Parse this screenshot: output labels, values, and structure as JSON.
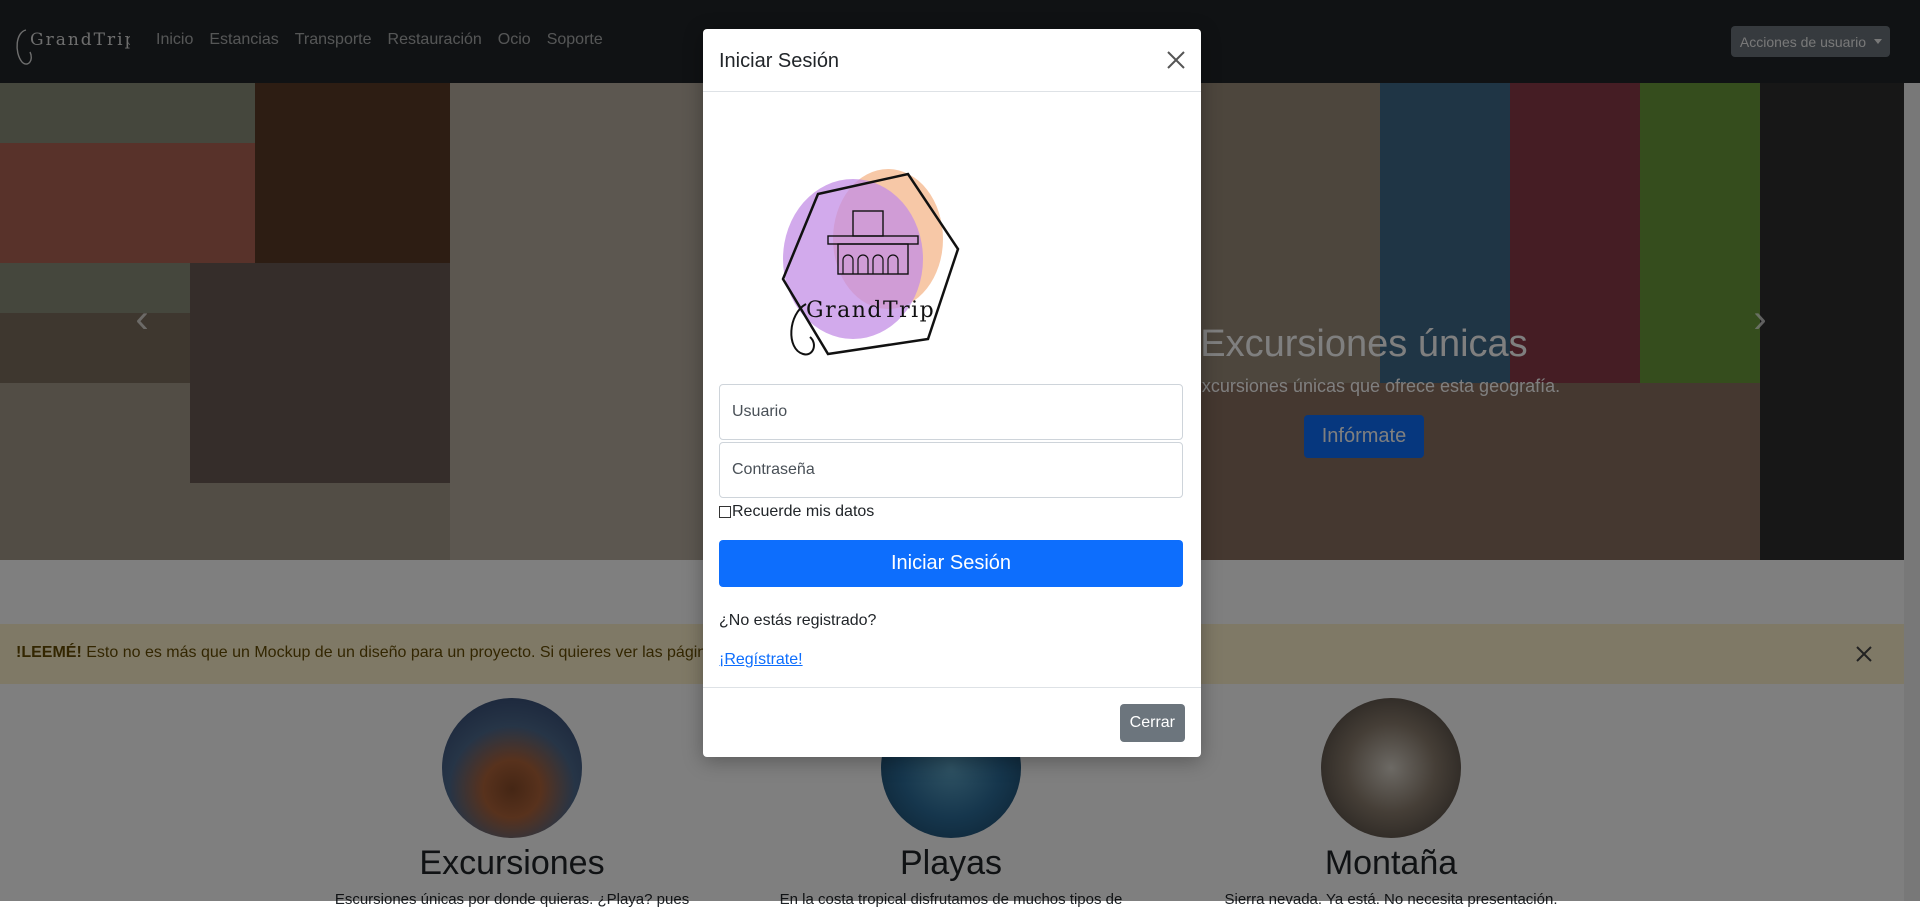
{
  "navbar": {
    "brand_text": "GrandTrip",
    "links": [
      "Inicio",
      "Estancias",
      "Transporte",
      "Restauración",
      "Ocio",
      "Soporte"
    ],
    "user_actions": "Acciones de usuario"
  },
  "carousel": {
    "caption_title": "Excursiones únicas",
    "caption_text": "as excursiones únicas que ofrece esta geografía.",
    "caption_button": "Infórmate"
  },
  "alert": {
    "strong": "!LEEMÉ!",
    "text": "Esto no es más que un Mockup de un diseño para un proyecto. Si quieres ver las páginas"
  },
  "features": [
    {
      "name": "Excursiones",
      "description": "Escursiones únicas por donde quieras. ¿Playa? pues"
    },
    {
      "name": "Playas",
      "description": "En la costa tropical disfrutamos de muchos tipos de"
    },
    {
      "name": "Montaña",
      "description": "Sierra nevada. Ya está. No necesita presentación."
    }
  ],
  "modal": {
    "title": "Iniciar Sesión",
    "logo_text": "GrandTrip",
    "username_placeholder": "Usuario",
    "password_placeholder": "Contraseña",
    "remember_label": "Recuerde mis datos",
    "login_button": "Iniciar Sesión",
    "not_registered": "¿No estás registrado?",
    "register_link": "¡Regístrate!",
    "close_button": "Cerrar"
  },
  "colors": {
    "primary": "#0d6efd",
    "secondary": "#6c757d",
    "navbar": "#212529",
    "alert_bg": "#fff3cd",
    "logo_purple": "#c38ee6",
    "logo_orange": "#f4b58a"
  }
}
